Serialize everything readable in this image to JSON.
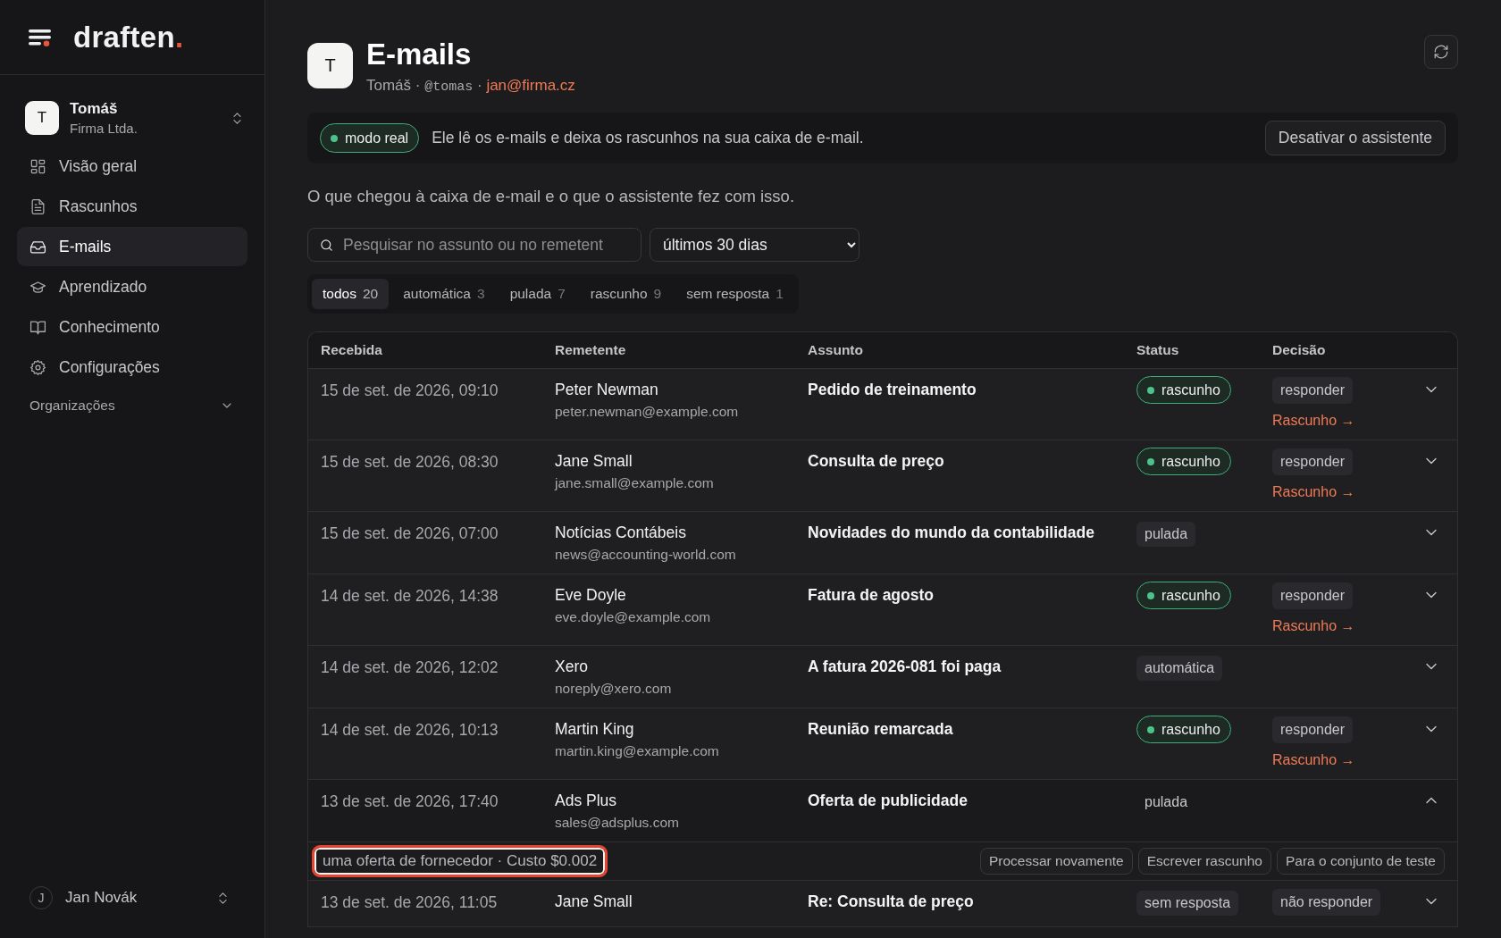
{
  "sidebar": {
    "logo": "draften",
    "logo_dot": ".",
    "workspace": {
      "initial": "T",
      "name": "Tomáš",
      "company": "Firma Ltda."
    },
    "nav": [
      {
        "label": "Visão geral",
        "selected": false
      },
      {
        "label": "Rascunhos",
        "selected": false
      },
      {
        "label": "E-mails",
        "selected": true
      },
      {
        "label": "Aprendizado",
        "selected": false
      },
      {
        "label": "Conhecimento",
        "selected": false
      },
      {
        "label": "Configurações",
        "selected": false
      }
    ],
    "section": {
      "label": "Organizações",
      "expanded": false
    },
    "user": {
      "initial": "J",
      "name": "Jan Novák"
    }
  },
  "header": {
    "initial": "T",
    "title": "E-mails",
    "name": "Tomáš",
    "separator": "·",
    "handle": "@tomas",
    "email": "jan@firma.cz"
  },
  "banner": {
    "mode": "modo real",
    "live": true,
    "text": "Ele lê os e-mails e deixa os rascunhos na sua caixa de e-mail.",
    "button": "Desativar o assistente"
  },
  "description": "O que chegou à caixa de e-mail e o que o assistente fez com isso.",
  "search": {
    "placeholder": "Pesquisar no assunto ou no remetent"
  },
  "period": "últimos 30 dias",
  "filters": [
    {
      "label": "todos",
      "count": "20",
      "selected": true
    },
    {
      "label": "automática",
      "count": "3",
      "selected": false
    },
    {
      "label": "pulada",
      "count": "7",
      "selected": false
    },
    {
      "label": "rascunho",
      "count": "9",
      "selected": false
    },
    {
      "label": "sem resposta",
      "count": "1",
      "selected": false
    }
  ],
  "table": {
    "columns": [
      "Recebida",
      "Remetente",
      "Assunto",
      "Status",
      "Decisão"
    ],
    "rows": [
      {
        "received": "15 de set. de 2026, 09:10",
        "sender": "Peter Newman",
        "email": "peter.newman@example.com",
        "subject": "Pedido de treinamento",
        "status": {
          "label": "rascunho",
          "kind": "draft"
        },
        "decision": "responder",
        "link": "Rascunho →",
        "expanded": false
      },
      {
        "received": "15 de set. de 2026, 08:30",
        "sender": "Jane Small",
        "email": "jane.small@example.com",
        "subject": "Consulta de preço",
        "status": {
          "label": "rascunho",
          "kind": "draft"
        },
        "decision": "responder",
        "link": "Rascunho →",
        "expanded": false
      },
      {
        "received": "15 de set. de 2026, 07:00",
        "sender": "Notícias Contábeis",
        "email": "news@accounting-world.com",
        "subject": "Novidades do mundo da contabilidade",
        "status": {
          "label": "pulada",
          "kind": "tag"
        },
        "expanded": false
      },
      {
        "received": "14 de set. de 2026, 14:38",
        "sender": "Eve Doyle",
        "email": "eve.doyle@example.com",
        "subject": "Fatura de agosto",
        "status": {
          "label": "rascunho",
          "kind": "draft"
        },
        "decision": "responder",
        "link": "Rascunho →",
        "expanded": false
      },
      {
        "received": "14 de set. de 2026, 12:02",
        "sender": "Xero",
        "email": "noreply@xero.com",
        "subject": "A fatura 2026-081 foi paga",
        "status": {
          "label": "automática",
          "kind": "tag"
        },
        "expanded": false
      },
      {
        "received": "14 de set. de 2026, 10:13",
        "sender": "Martin King",
        "email": "martin.king@example.com",
        "subject": "Reunião remarcada",
        "status": {
          "label": "rascunho",
          "kind": "draft"
        },
        "decision": "responder",
        "link": "Rascunho →",
        "expanded": false
      },
      {
        "received": "13 de set. de 2026, 17:40",
        "sender": "Ads Plus",
        "email": "sales@adsplus.com",
        "subject": "Oferta de publicidade",
        "status": {
          "label": "pulada",
          "kind": "plain"
        },
        "expanded": true,
        "detail": {
          "note": "uma oferta de fornecedor · Custo $0.002",
          "highlighted": true,
          "actions": [
            "Processar novamente",
            "Escrever rascunho",
            "Para o conjunto de teste"
          ]
        }
      },
      {
        "received": "13 de set. de 2026, 11:05",
        "sender": "Jane Small",
        "subject": "Re: Consulta de preço",
        "status": {
          "label": "sem resposta",
          "kind": "tag"
        },
        "decision": "não responder",
        "expanded": false
      }
    ]
  }
}
